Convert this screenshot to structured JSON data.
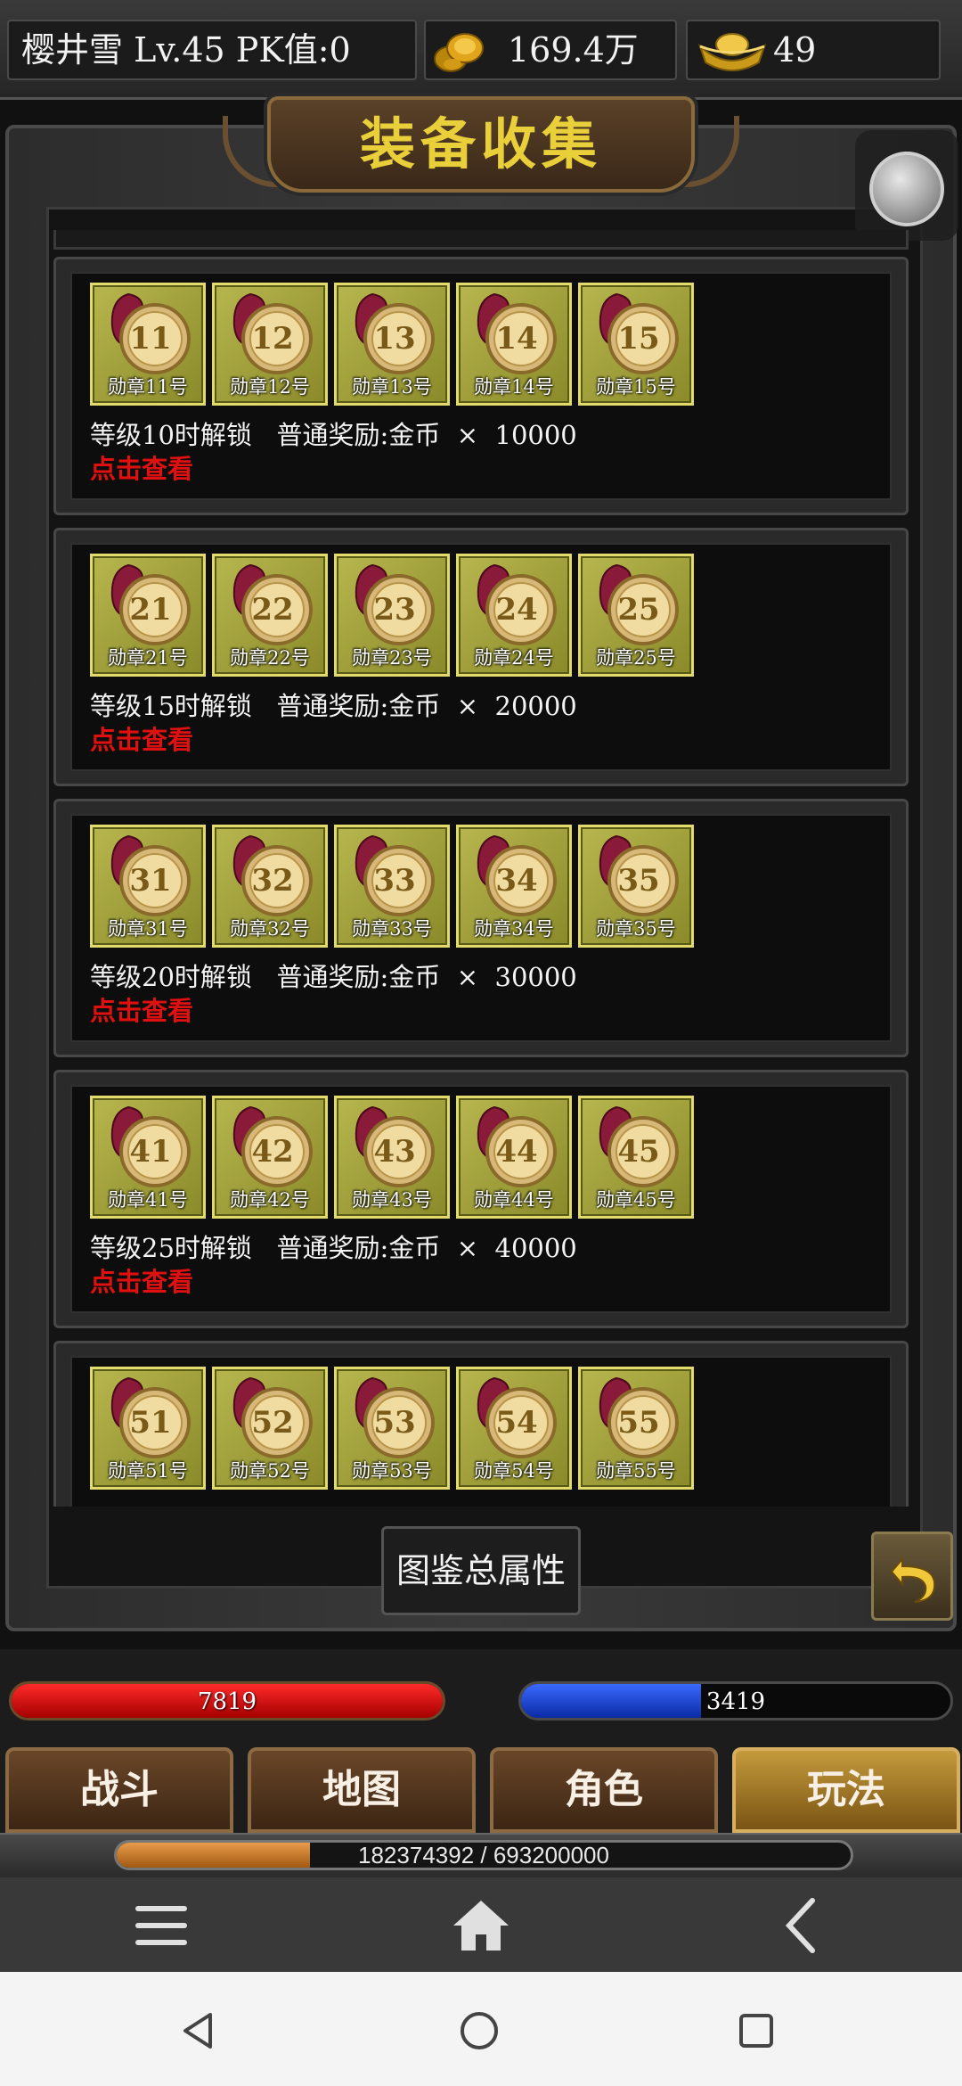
{
  "header": {
    "player_info": "樱井雪  Lv.45 PK值:0",
    "gold": "169.4万",
    "ingot": "49",
    "icons": [
      "gold-coin-icon",
      "gold-ingot-icon"
    ]
  },
  "panel": {
    "title": "装备收集",
    "total_attributes_button": "图鉴总属性",
    "back_icon": "return-arrow-icon",
    "toggle_icon": "floating-ball-icon"
  },
  "groups": [
    {
      "medals": [
        {
          "num": "11",
          "label": "勋章11号"
        },
        {
          "num": "12",
          "label": "勋章12号"
        },
        {
          "num": "13",
          "label": "勋章13号"
        },
        {
          "num": "14",
          "label": "勋章14号"
        },
        {
          "num": "15",
          "label": "勋章15号"
        }
      ],
      "unlock_text": "等级10时解锁   普通奖励:金币  ×  10000",
      "view_link": "点击查看"
    },
    {
      "medals": [
        {
          "num": "21",
          "label": "勋章21号"
        },
        {
          "num": "22",
          "label": "勋章22号"
        },
        {
          "num": "23",
          "label": "勋章23号"
        },
        {
          "num": "24",
          "label": "勋章24号"
        },
        {
          "num": "25",
          "label": "勋章25号"
        }
      ],
      "unlock_text": "等级15时解锁   普通奖励:金币  ×  20000",
      "view_link": "点击查看"
    },
    {
      "medals": [
        {
          "num": "31",
          "label": "勋章31号"
        },
        {
          "num": "32",
          "label": "勋章32号"
        },
        {
          "num": "33",
          "label": "勋章33号"
        },
        {
          "num": "34",
          "label": "勋章34号"
        },
        {
          "num": "35",
          "label": "勋章35号"
        }
      ],
      "unlock_text": "等级20时解锁   普通奖励:金币  ×  30000",
      "view_link": "点击查看"
    },
    {
      "medals": [
        {
          "num": "41",
          "label": "勋章41号"
        },
        {
          "num": "42",
          "label": "勋章42号"
        },
        {
          "num": "43",
          "label": "勋章43号"
        },
        {
          "num": "44",
          "label": "勋章44号"
        },
        {
          "num": "45",
          "label": "勋章45号"
        }
      ],
      "unlock_text": "等级25时解锁   普通奖励:金币  ×  40000",
      "view_link": "点击查看"
    },
    {
      "medals": [
        {
          "num": "51",
          "label": "勋章51号"
        },
        {
          "num": "52",
          "label": "勋章52号"
        },
        {
          "num": "53",
          "label": "勋章53号"
        },
        {
          "num": "54",
          "label": "勋章54号"
        },
        {
          "num": "55",
          "label": "勋章55号"
        }
      ],
      "unlock_text": "",
      "view_link": ""
    }
  ],
  "stats": {
    "hp": "7819",
    "mp": "3419",
    "mp_fill_fraction": 0.42,
    "xp_text": "182374392 / 693200000",
    "xp_fill_fraction": 0.263
  },
  "tabs": [
    {
      "label": "战斗",
      "active": false
    },
    {
      "label": "地图",
      "active": false
    },
    {
      "label": "角色",
      "active": false
    },
    {
      "label": "玩法",
      "active": true
    }
  ],
  "browser_bar": {
    "icons": [
      "menu-icon",
      "home-icon",
      "back-chevron-icon"
    ]
  },
  "android_nav": {
    "icons": [
      "nav-back-icon",
      "nav-home-icon",
      "nav-recents-icon"
    ]
  },
  "colors": {
    "title": "#e9cf3a",
    "link": "#e01010",
    "hp": "#d81010",
    "mp": "#2a5aef",
    "xp": "#d08a3a"
  }
}
